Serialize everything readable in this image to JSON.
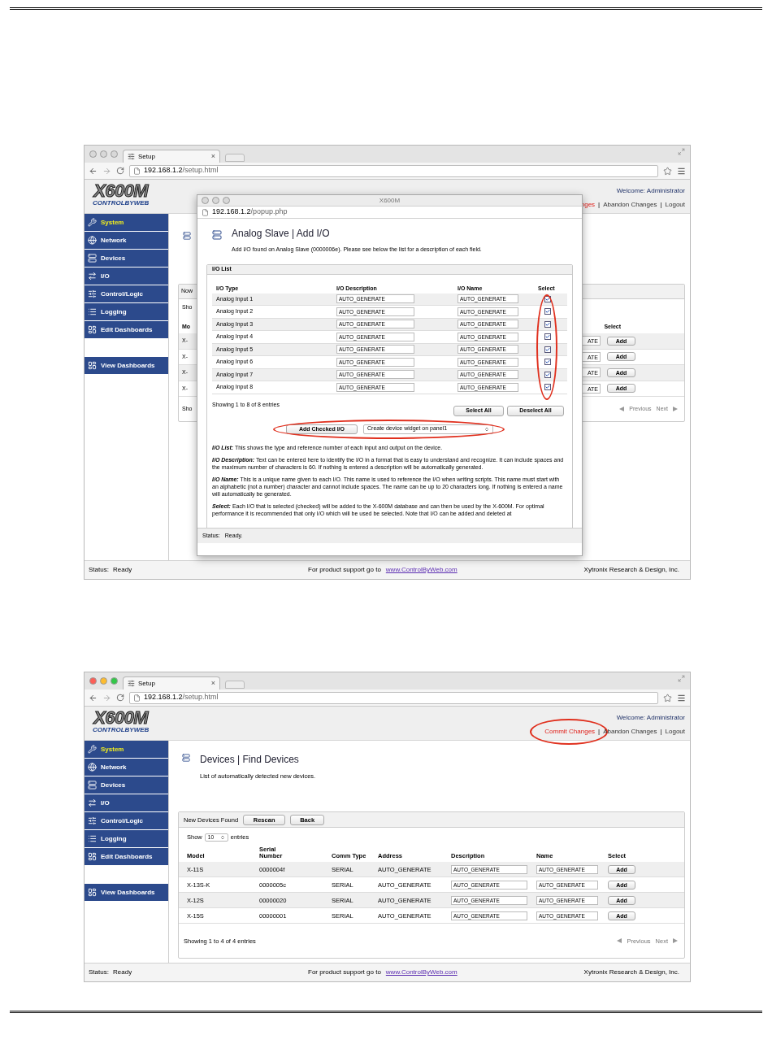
{
  "screenshot_1": {
    "window_active": false,
    "tab": "Setup",
    "tab_close": "×",
    "url_host": "192.168.1.2",
    "url_path": "/setup.html",
    "logo": {
      "title": "X600M",
      "subtitle": "CONTROLBYWEB"
    },
    "welcome": "Welcome: Administrator",
    "link_separator": "|",
    "header_links": [
      {
        "text": "nges",
        "kind": "commit",
        "highlighted": false
      },
      {
        "text": "Abandon Changes",
        "kind": "plain",
        "highlighted": false
      },
      {
        "text": "Logout",
        "kind": "plain",
        "highlighted": false
      }
    ],
    "sidebar": {
      "items": [
        {
          "label": "System",
          "selected": true
        },
        {
          "label": "Network",
          "selected": false
        },
        {
          "label": "Devices",
          "selected": false
        },
        {
          "label": "I/O",
          "selected": false
        },
        {
          "label": "Control/Logic",
          "selected": false
        },
        {
          "label": "Logging",
          "selected": false
        },
        {
          "label": "Edit Dashboards",
          "selected": false
        }
      ],
      "extra_items": [
        {
          "label": "View Dashboards",
          "selected": false
        }
      ]
    },
    "background_panel": {
      "toolbar_label": "Now",
      "show_label": "Sho",
      "header_left": "Mo",
      "header_right": "Select",
      "rows": [
        {
          "left": "X-",
          "field": "ATE",
          "button": "Add"
        },
        {
          "left": "X-",
          "field": "ATE",
          "button": "Add"
        },
        {
          "left": "X-",
          "field": "ATE",
          "button": "Add"
        },
        {
          "left": "X-",
          "field": "ATE",
          "button": "Add"
        }
      ],
      "footer_left": "Sho",
      "previous": "Previous",
      "next": "Next"
    },
    "popup": {
      "title": "X600M",
      "url_host": "192.168.1.2",
      "url_path": "/popup.php",
      "heading": "Analog Slave | Add I/O",
      "subtitle": "Add I/O found on Analog Slave (0000006e). Please see below the list for a description of each field.",
      "panel_title": "I/O List",
      "columns": [
        "I/O Type",
        "I/O Description",
        "I/O Name",
        "Select"
      ],
      "select_highlighted": true,
      "rows": [
        {
          "type": "Analog Input 1",
          "description": "AUTO_GENERATE",
          "name": "AUTO_GENERATE",
          "checked": true
        },
        {
          "type": "Analog Input 2",
          "description": "AUTO_GENERATE",
          "name": "AUTO_GENERATE",
          "checked": true
        },
        {
          "type": "Analog Input 3",
          "description": "AUTO_GENERATE",
          "name": "AUTO_GENERATE",
          "checked": true
        },
        {
          "type": "Analog Input 4",
          "description": "AUTO_GENERATE",
          "name": "AUTO_GENERATE",
          "checked": true
        },
        {
          "type": "Analog Input 5",
          "description": "AUTO_GENERATE",
          "name": "AUTO_GENERATE",
          "checked": true
        },
        {
          "type": "Analog Input 6",
          "description": "AUTO_GENERATE",
          "name": "AUTO_GENERATE",
          "checked": true
        },
        {
          "type": "Analog Input 7",
          "description": "AUTO_GENERATE",
          "name": "AUTO_GENERATE",
          "checked": true
        },
        {
          "type": "Analog Input 8",
          "description": "AUTO_GENERATE",
          "name": "AUTO_GENERATE",
          "checked": true
        }
      ],
      "showing": "Showing 1 to 8 of 8 entries",
      "select_all": "Select All",
      "deselect_all": "Deselect All",
      "add_row": {
        "button": "Add Checked I/O",
        "dropdown": "Create device widget on panel1",
        "highlighted": true
      },
      "help": [
        {
          "lead": "I/O List:",
          "text": "This shows the type and reference number of each input and output on the device."
        },
        {
          "lead": "I/O Description:",
          "text": "Text can be entered here to identify the I/O in a format that is easy to understand and recognize. It can include spaces and the maximum number of characters is 60. If nothing is entered a description will be automatically generated."
        },
        {
          "lead": "I/O Name:",
          "text": "This is a unique name given to each I/O. This name is used to reference the I/O when writing scripts. This name must start with an alphabetic (not a number) character and cannot include spaces. The name can be up to 20 characters long. If nothing is entered a name will automatically be generated."
        },
        {
          "lead": "Select:",
          "text": "Each I/O that is selected (checked) will be added to the X-600M database and can then be used by the X-600M. For optimal performance it is recommended that only I/O which will be used be selected. Note that I/O can be added and deleted at"
        }
      ],
      "status_label": "Status:",
      "status": "Ready."
    },
    "footer": {
      "status_label": "Status:",
      "status": "Ready",
      "support": "For product support go to",
      "link": "www.ControlByWeb.com",
      "company": "Xytronix Research & Design, Inc."
    }
  },
  "screenshot_2": {
    "window_active": true,
    "tab": "Setup",
    "tab_close": "×",
    "url_host": "192.168.1.2",
    "url_path": "/setup.html",
    "logo": {
      "title": "X600M",
      "subtitle": "CONTROLBYWEB"
    },
    "welcome": "Welcome: Administrator",
    "link_separator": "|",
    "header_links": [
      {
        "text": "Commit Changes",
        "kind": "commit",
        "highlighted": true
      },
      {
        "text": "Abandon Changes",
        "kind": "plain",
        "highlighted": false
      },
      {
        "text": "Logout",
        "kind": "plain",
        "highlighted": false
      }
    ],
    "sidebar": {
      "items": [
        {
          "label": "System",
          "selected": true
        },
        {
          "label": "Network",
          "selected": false
        },
        {
          "label": "Devices",
          "selected": false
        },
        {
          "label": "I/O",
          "selected": false
        },
        {
          "label": "Control/Logic",
          "selected": false
        },
        {
          "label": "Logging",
          "selected": false
        },
        {
          "label": "Edit Dashboards",
          "selected": false
        }
      ],
      "extra_items": [
        {
          "label": "View Dashboards",
          "selected": false
        }
      ]
    },
    "main": {
      "title": "Devices | Find Devices",
      "subtitle": "List of automatically detected new devices.",
      "toolbar_label": "New Devices Found",
      "rescan": "Rescan",
      "back": "Back",
      "show_label": "Show",
      "show_value": "10",
      "entries_label": "entries",
      "columns": [
        "Model",
        "Serial Number",
        "Comm Type",
        "Address",
        "Description",
        "Name",
        "Select"
      ],
      "rows": [
        {
          "model": "X-11S",
          "serial": "0000004f",
          "comm": "SERIAL",
          "address": "AUTO_GENERATE",
          "description": "AUTO_GENERATE",
          "name": "AUTO_GENERATE",
          "button": "Add"
        },
        {
          "model": "X-13S-K",
          "serial": "0000005c",
          "comm": "SERIAL",
          "address": "AUTO_GENERATE",
          "description": "AUTO_GENERATE",
          "name": "AUTO_GENERATE",
          "button": "Add"
        },
        {
          "model": "X-12S",
          "serial": "00000020",
          "comm": "SERIAL",
          "address": "AUTO_GENERATE",
          "description": "AUTO_GENERATE",
          "name": "AUTO_GENERATE",
          "button": "Add"
        },
        {
          "model": "X-15S",
          "serial": "00000001",
          "comm": "SERIAL",
          "address": "AUTO_GENERATE",
          "description": "AUTO_GENERATE",
          "name": "AUTO_GENERATE",
          "button": "Add"
        }
      ],
      "showing": "Showing 1 to 4 of 4 entries",
      "previous": "Previous",
      "next": "Next"
    },
    "footer": {
      "status_label": "Status:",
      "status": "Ready",
      "support": "For product support go to",
      "link": "www.ControlByWeb.com",
      "company": "Xytronix Research & Design, Inc."
    }
  }
}
